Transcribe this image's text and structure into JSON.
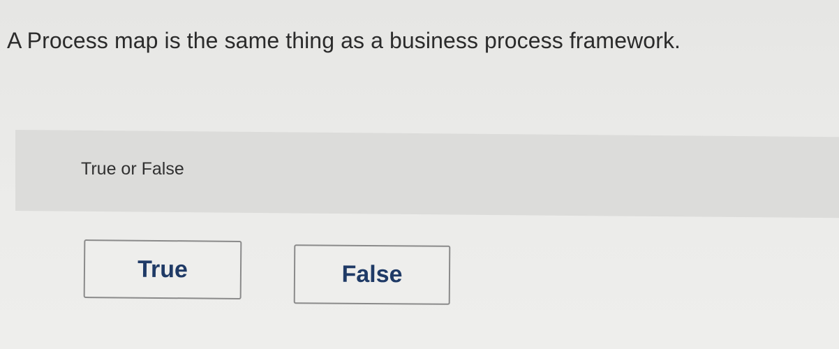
{
  "question": {
    "text": "A Process map is the same thing as a business process framework."
  },
  "answer_area": {
    "type_label": "True or False",
    "choices": [
      {
        "label": "True"
      },
      {
        "label": "False"
      }
    ]
  },
  "colors": {
    "choice_text": "#1f3a66",
    "choice_border": "#8a8a8a",
    "panel_background": "#dcdcda"
  }
}
